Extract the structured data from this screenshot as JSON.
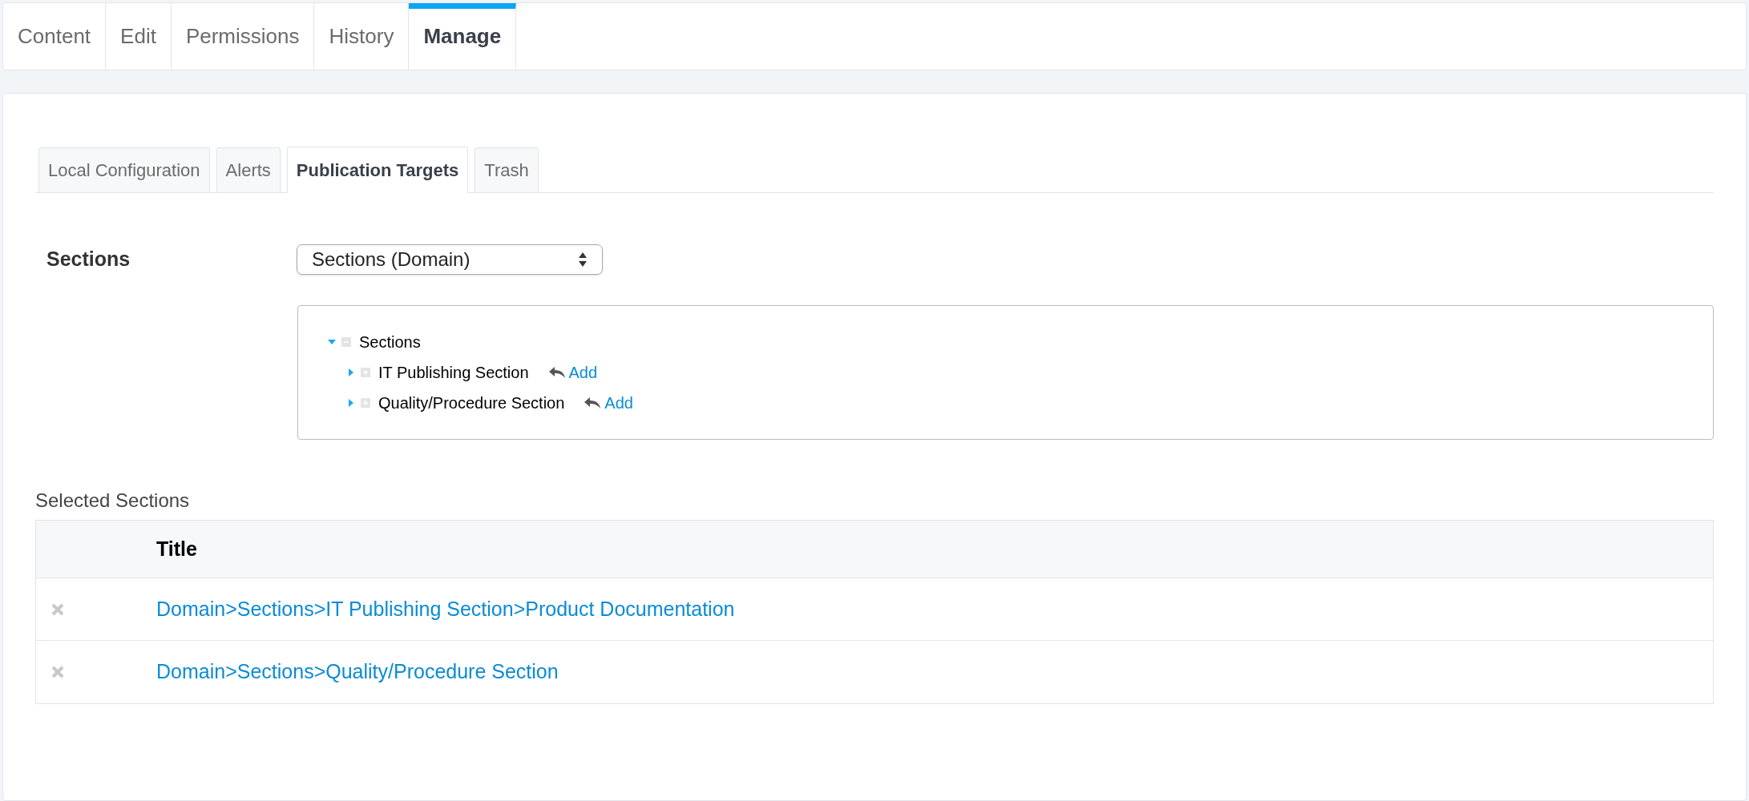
{
  "tabs": [
    {
      "label": "Content",
      "selected": false
    },
    {
      "label": "Edit",
      "selected": false
    },
    {
      "label": "Permissions",
      "selected": false
    },
    {
      "label": "History",
      "selected": false
    },
    {
      "label": "Manage",
      "selected": true
    }
  ],
  "subtabs": [
    {
      "label": "Local Configuration",
      "selected": false
    },
    {
      "label": "Alerts",
      "selected": false
    },
    {
      "label": "Publication Targets",
      "selected": true
    },
    {
      "label": "Trash",
      "selected": false
    }
  ],
  "sections": {
    "label": "Sections",
    "select_value": "Sections (Domain)",
    "tree": [
      {
        "label": "Sections",
        "expanded": true,
        "children": [
          {
            "label": "IT Publishing Section",
            "expanded": false,
            "action": "Add"
          },
          {
            "label": "Quality/Procedure Section",
            "expanded": false,
            "action": "Add"
          }
        ]
      }
    ]
  },
  "selected_sections": {
    "title": "Selected Sections",
    "columns": [
      "Title"
    ],
    "rows": [
      {
        "title": "Domain>Sections>IT Publishing Section>Product Documentation"
      },
      {
        "title": "Domain>Sections>Quality/Procedure Section"
      }
    ]
  }
}
